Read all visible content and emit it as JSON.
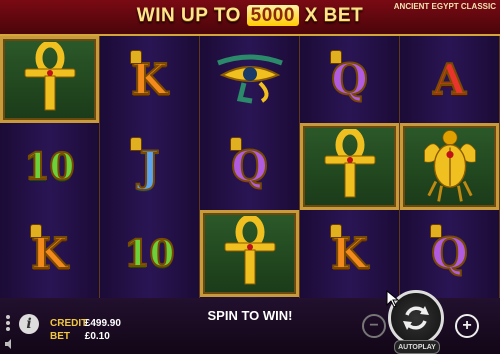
{
  "header": {
    "banner_prefix": "WIN UP TO",
    "banner_multiplier": "5000",
    "banner_suffix": "X BET",
    "game_title": "ANCIENT EGYPT CLASSIC"
  },
  "reels": [
    [
      "ankh-icon",
      "10",
      "K"
    ],
    [
      "K",
      "J",
      "10"
    ],
    [
      "eye-of-horus-icon",
      "Q",
      "ankh-icon"
    ],
    [
      "Q",
      "ankh-icon",
      "K"
    ],
    [
      "A",
      "scarab-icon",
      "Q"
    ]
  ],
  "highlighted_cells": [
    "0-0",
    "2-2",
    "3-1",
    "4-1"
  ],
  "footer": {
    "credit_label": "CREDIT",
    "credit_value": "£499.90",
    "bet_label": "BET",
    "bet_value": "£0.10",
    "spin_message": "SPIN TO WIN!",
    "autoplay_label": "AUTOPLAY"
  },
  "colors": {
    "banner_red": "#7a0a14",
    "gold": "#d4a538",
    "reel_bg": "#2a1554"
  }
}
